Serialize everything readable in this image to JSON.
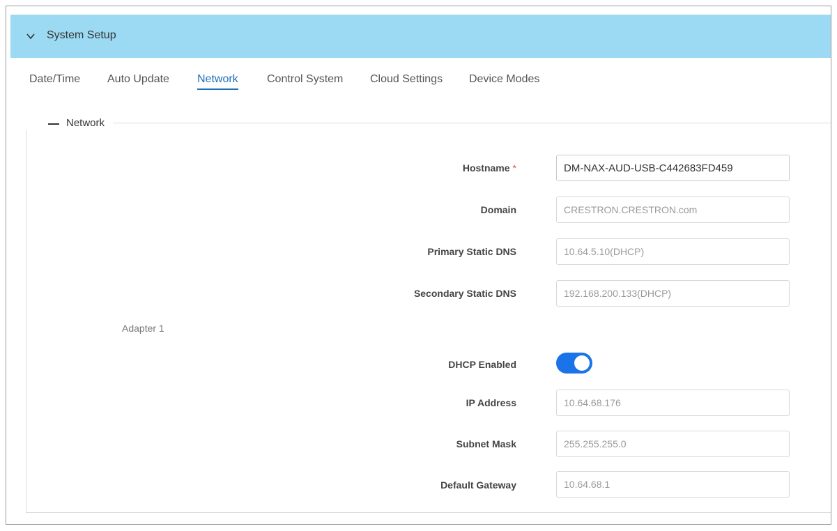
{
  "header": {
    "title": "System Setup",
    "icon": "chevron-down-icon"
  },
  "tabs": [
    {
      "label": "Date/Time",
      "active": false
    },
    {
      "label": "Auto Update",
      "active": false
    },
    {
      "label": "Network",
      "active": true
    },
    {
      "label": "Control System",
      "active": false
    },
    {
      "label": "Cloud Settings",
      "active": false
    },
    {
      "label": "Device Modes",
      "active": false
    }
  ],
  "section": {
    "title": "Network",
    "collapse_icon": "minus-icon"
  },
  "fields": {
    "hostname": {
      "label": "Hostname",
      "required_mark": "*",
      "value": "DM-NAX-AUD-USB-C442683FD459"
    },
    "domain": {
      "label": "Domain",
      "value": "CRESTRON.CRESTRON.com"
    },
    "primary_dns": {
      "label": "Primary Static DNS",
      "value": "10.64.5.10(DHCP)"
    },
    "secondary_dns": {
      "label": "Secondary Static DNS",
      "value": "192.168.200.133(DHCP)"
    }
  },
  "adapter": {
    "title": "Adapter 1",
    "dhcp": {
      "label": "DHCP Enabled",
      "enabled": true
    },
    "ip_address": {
      "label": "IP Address",
      "value": "10.64.68.176"
    },
    "subnet_mask": {
      "label": "Subnet Mask",
      "value": "255.255.255.0"
    },
    "default_gateway": {
      "label": "Default Gateway",
      "value": "10.64.68.1"
    }
  },
  "colors": {
    "header_bg": "#9cdaf3",
    "active_tab": "#1e6fb8",
    "toggle_on": "#1a73e8",
    "required": "#d9534f"
  }
}
